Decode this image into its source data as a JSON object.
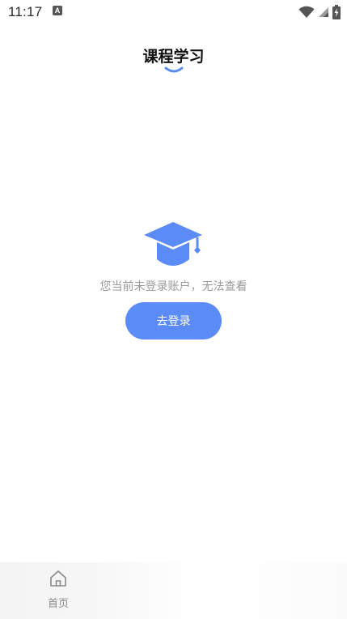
{
  "status_bar": {
    "time": "11:17",
    "notification_icon": "a-badge-icon",
    "icons": [
      "wifi-icon",
      "signal-icon",
      "battery-charging-icon"
    ]
  },
  "header": {
    "title": "课程学习"
  },
  "empty_state": {
    "icon": "graduation-cap-icon",
    "message": "您当前未登录账户，无法查看",
    "login_button_label": "去登录"
  },
  "tab_bar": {
    "tabs": [
      {
        "label": "首页",
        "icon": "home-icon"
      }
    ]
  },
  "colors": {
    "accent": "#5b8bf7",
    "text_muted": "#9a9a9a",
    "background": "#ffffff"
  }
}
